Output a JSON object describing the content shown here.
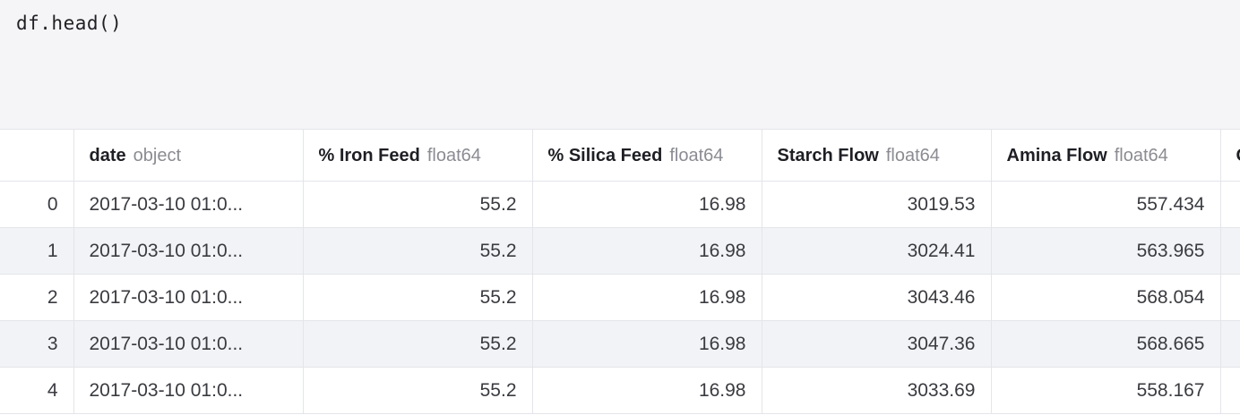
{
  "code": "df.head()",
  "table": {
    "columns": [
      {
        "name": "date",
        "dtype": "object"
      },
      {
        "name": "% Iron Feed",
        "dtype": "float64"
      },
      {
        "name": "% Silica Feed",
        "dtype": "float64"
      },
      {
        "name": "Starch Flow",
        "dtype": "float64"
      },
      {
        "name": "Amina Flow",
        "dtype": "float64"
      },
      {
        "name": "O",
        "dtype": ""
      }
    ],
    "rows": [
      {
        "index": "0",
        "date": "2017-03-10 01:0...",
        "iron_feed": "55.2",
        "silica_feed": "16.98",
        "starch_flow": "3019.53",
        "amina_flow": "557.434"
      },
      {
        "index": "1",
        "date": "2017-03-10 01:0...",
        "iron_feed": "55.2",
        "silica_feed": "16.98",
        "starch_flow": "3024.41",
        "amina_flow": "563.965"
      },
      {
        "index": "2",
        "date": "2017-03-10 01:0...",
        "iron_feed": "55.2",
        "silica_feed": "16.98",
        "starch_flow": "3043.46",
        "amina_flow": "568.054"
      },
      {
        "index": "3",
        "date": "2017-03-10 01:0...",
        "iron_feed": "55.2",
        "silica_feed": "16.98",
        "starch_flow": "3047.36",
        "amina_flow": "568.665"
      },
      {
        "index": "4",
        "date": "2017-03-10 01:0...",
        "iron_feed": "55.2",
        "silica_feed": "16.98",
        "starch_flow": "3033.69",
        "amina_flow": "558.167"
      }
    ]
  },
  "colors": {
    "code_background": "#f5f5f7",
    "row_stripe": "#f2f3f6",
    "grid_line": "#e4e5ea",
    "dtype_text": "#8b8c92"
  }
}
